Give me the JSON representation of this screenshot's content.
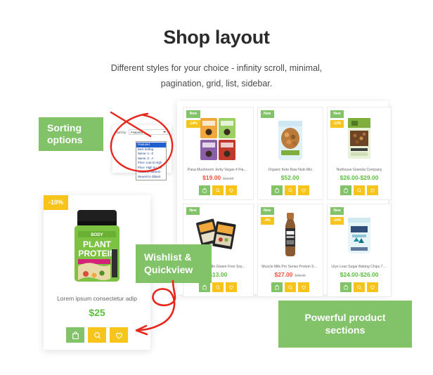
{
  "header": {
    "title": "Shop layout",
    "subtitle_line1": "Different styles for your choice - infinity scroll, minimal,",
    "subtitle_line2": "pagination, grid, list, sidebar."
  },
  "callouts": {
    "sorting": "Sorting options",
    "wishlist": "Wishlist & Quickview",
    "sections": "Powerful product sections"
  },
  "sorting_panel": {
    "label": "Sort by:",
    "selected": "Featured",
    "options": [
      "Featured",
      "Best Selling",
      "Name: A - Z",
      "Name: Z - A",
      "Price: Low to High",
      "Price: High to Low",
      "Oldest to Newest",
      "Newest to Oldest"
    ]
  },
  "featured_product": {
    "badge": "-10%",
    "title": "Lorem ipsum consectetur adip",
    "price": "$25",
    "actions": {
      "cart": "add-to-cart",
      "quickview": "quick-view",
      "wishlist": "add-to-wishlist"
    }
  },
  "products": [
    {
      "badge_new": "New",
      "badge_sale": "-14%",
      "title": "Pana Mushroom Jerky Vegan 4 Flavor...",
      "price": "$19.00",
      "price_old": "$22.00",
      "on_sale": true
    },
    {
      "badge_new": "New",
      "badge_sale": "",
      "title": "Organic Keto Raw Nuts Mix",
      "price": "$52.00",
      "price_old": "",
      "on_sale": false
    },
    {
      "badge_new": "New",
      "badge_sale": "-13%",
      "title": "Nuthouse Granola Company",
      "price": "$26.00-$29.00",
      "price_old": "",
      "on_sale": false
    },
    {
      "badge_new": "New",
      "badge_sale": "",
      "title": "Miracle Noodle Gluten Free Soy...",
      "price": "$13.00",
      "price_old": "",
      "on_sale": false
    },
    {
      "badge_new": "New",
      "badge_sale": "-4%",
      "title": "Muscle Milk Pro Series Protein Sho...",
      "price": "$27.00",
      "price_old": "$28.00",
      "on_sale": true
    },
    {
      "badge_new": "New",
      "badge_sale": "-14%",
      "title": "Lilys Less Sugar Baking Chips 7oz...",
      "price": "$24.00-$26.00",
      "price_old": "",
      "on_sale": false
    }
  ],
  "colors": {
    "green": "#82c36a",
    "yellow": "#f7c41c",
    "price_green": "#5cbf3c",
    "sale_red": "#f0503a",
    "annotation_red": "#e8261c"
  }
}
